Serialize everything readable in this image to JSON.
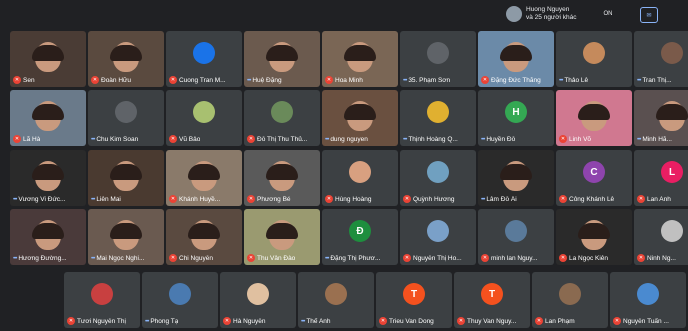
{
  "presenter": {
    "line1": "Huong Nguyen",
    "line2": "và 25 người khác"
  },
  "toolbar": {
    "pin_label": "ON"
  },
  "colors": {
    "background": "#202124",
    "tile": "#3c4043",
    "mic_muted": "#ea4335",
    "speaking": "#8ab4f8"
  },
  "tiles": [
    {
      "name": "Sen",
      "status": "muted",
      "kind": "video",
      "bg": "#4a3c35"
    },
    {
      "name": "Đoàn Hữu",
      "status": "muted",
      "kind": "video",
      "bg": "#5a4a3f"
    },
    {
      "name": "Cuong Tran M...",
      "status": "muted",
      "kind": "avatar",
      "initial": "",
      "avatar_color": "#1a73e8"
    },
    {
      "name": "Huệ Đặng",
      "status": "speaking",
      "kind": "video",
      "bg": "#6b5a4e"
    },
    {
      "name": "Hoa Minh",
      "status": "muted",
      "kind": "video",
      "bg": "#7a6655"
    },
    {
      "name": "35. Phạm Sơn",
      "status": "speaking",
      "kind": "avatar",
      "initial": "",
      "avatar_color": "#5f6368"
    },
    {
      "name": "Đặng Đức Thắng",
      "status": "muted",
      "kind": "video",
      "bg": "#6b8aa8"
    },
    {
      "name": "Thảo Lê",
      "status": "speaking",
      "kind": "avatar",
      "initial": "",
      "avatar_color": "#c58a5c"
    },
    {
      "name": "Tran Thị...",
      "status": "speaking",
      "kind": "avatar",
      "initial": "",
      "avatar_color": "#7a5a4a"
    },
    {
      "name": "Lã Hà",
      "status": "muted",
      "kind": "video",
      "bg": "#6a7a8a"
    },
    {
      "name": "Chu Kim Soan",
      "status": "speaking",
      "kind": "avatar",
      "initial": "",
      "avatar_color": "#5f6368"
    },
    {
      "name": "Vũ Bảo",
      "status": "muted",
      "kind": "avatar",
      "initial": "",
      "avatar_color": "#a8c070"
    },
    {
      "name": "Đỗ Thị Thu Thủ...",
      "status": "muted",
      "kind": "avatar",
      "initial": "",
      "avatar_color": "#6a8a5a"
    },
    {
      "name": "dung nguyen",
      "status": "speaking",
      "kind": "video",
      "bg": "#6a5040"
    },
    {
      "name": "Thịnh Hoàng Q...",
      "status": "speaking",
      "kind": "avatar",
      "initial": "",
      "avatar_color": "#e0b030"
    },
    {
      "name": "Huyền Đỗ",
      "status": "speaking",
      "kind": "avatar",
      "initial": "H",
      "avatar_color": "#34a853"
    },
    {
      "name": "Linh Võ",
      "status": "muted",
      "kind": "video",
      "bg": "#d07890"
    },
    {
      "name": "Minh Hằ...",
      "status": "speaking",
      "kind": "video",
      "bg": "#5a5050"
    },
    {
      "name": "Vương Vi Đức...",
      "status": "speaking",
      "kind": "video",
      "bg": "#2a2a2a"
    },
    {
      "name": "Liên Mai",
      "status": "speaking",
      "kind": "video",
      "bg": "#4a3a30"
    },
    {
      "name": "Khánh Huyề...",
      "status": "muted",
      "kind": "video",
      "bg": "#8a7a6a"
    },
    {
      "name": "Phương Bé",
      "status": "muted",
      "kind": "video",
      "bg": "#5a5a5a"
    },
    {
      "name": "Hùng Hoàng",
      "status": "muted",
      "kind": "avatar",
      "initial": "",
      "avatar_color": "#d8a080"
    },
    {
      "name": "Quỳnh Hương",
      "status": "muted",
      "kind": "avatar",
      "initial": "",
      "avatar_color": "#70a0c0"
    },
    {
      "name": "Lâm Đỗ Ái",
      "status": "speaking",
      "kind": "video",
      "bg": "#2a2a2a"
    },
    {
      "name": "Công Khánh Lê",
      "status": "muted",
      "kind": "avatar",
      "initial": "C",
      "avatar_color": "#8e44ad"
    },
    {
      "name": "Lan Anh",
      "status": "muted",
      "kind": "avatar",
      "initial": "L",
      "avatar_color": "#e91e63"
    },
    {
      "name": "Hương Đường...",
      "status": "speaking",
      "kind": "video",
      "bg": "#4a3a3a"
    },
    {
      "name": "Mai Ngọc Nghi...",
      "status": "speaking",
      "kind": "video",
      "bg": "#6a5a50"
    },
    {
      "name": "Chi Nguyễn",
      "status": "muted",
      "kind": "video",
      "bg": "#5a4a40"
    },
    {
      "name": "Thu Vân Đào",
      "status": "muted",
      "kind": "video",
      "bg": "#9a9a70"
    },
    {
      "name": "Đặng Thị Phươ...",
      "status": "speaking",
      "kind": "avatar",
      "initial": "Đ",
      "avatar_color": "#1e8e3e"
    },
    {
      "name": "Nguyễn Thị Ho...",
      "status": "muted",
      "kind": "avatar",
      "initial": "",
      "avatar_color": "#7aa0c8"
    },
    {
      "name": "minh lan Nguy...",
      "status": "muted",
      "kind": "avatar",
      "initial": "",
      "avatar_color": "#5a7a9a"
    },
    {
      "name": "La Ngọc Kiên",
      "status": "muted",
      "kind": "video",
      "bg": "#2a2a2a"
    },
    {
      "name": "Ninh Ng...",
      "status": "muted",
      "kind": "avatar",
      "initial": "",
      "avatar_color": "#c0c0c0"
    },
    {
      "name": "Tươi Nguyễn Thị",
      "status": "muted",
      "kind": "avatar",
      "initial": "",
      "avatar_color": "#c84040"
    },
    {
      "name": "Phong Tạ",
      "status": "speaking",
      "kind": "avatar",
      "initial": "",
      "avatar_color": "#4a7ab0"
    },
    {
      "name": "Hà Nguyễn",
      "status": "muted",
      "kind": "avatar",
      "initial": "",
      "avatar_color": "#e0c0a0"
    },
    {
      "name": "Thế Anh",
      "status": "speaking",
      "kind": "avatar",
      "initial": "",
      "avatar_color": "#9a7050"
    },
    {
      "name": "Trieu Van Dong",
      "status": "muted",
      "kind": "avatar",
      "initial": "T",
      "avatar_color": "#f4511e"
    },
    {
      "name": "Thuy Van Nguy...",
      "status": "muted",
      "kind": "avatar",
      "initial": "T",
      "avatar_color": "#f4511e"
    },
    {
      "name": "Lan Phạm",
      "status": "muted",
      "kind": "avatar",
      "initial": "",
      "avatar_color": "#8a6a50"
    },
    {
      "name": "Nguyễn Tuấn ...",
      "status": "muted",
      "kind": "avatar",
      "initial": "",
      "avatar_color": "#4a8ad0"
    }
  ]
}
